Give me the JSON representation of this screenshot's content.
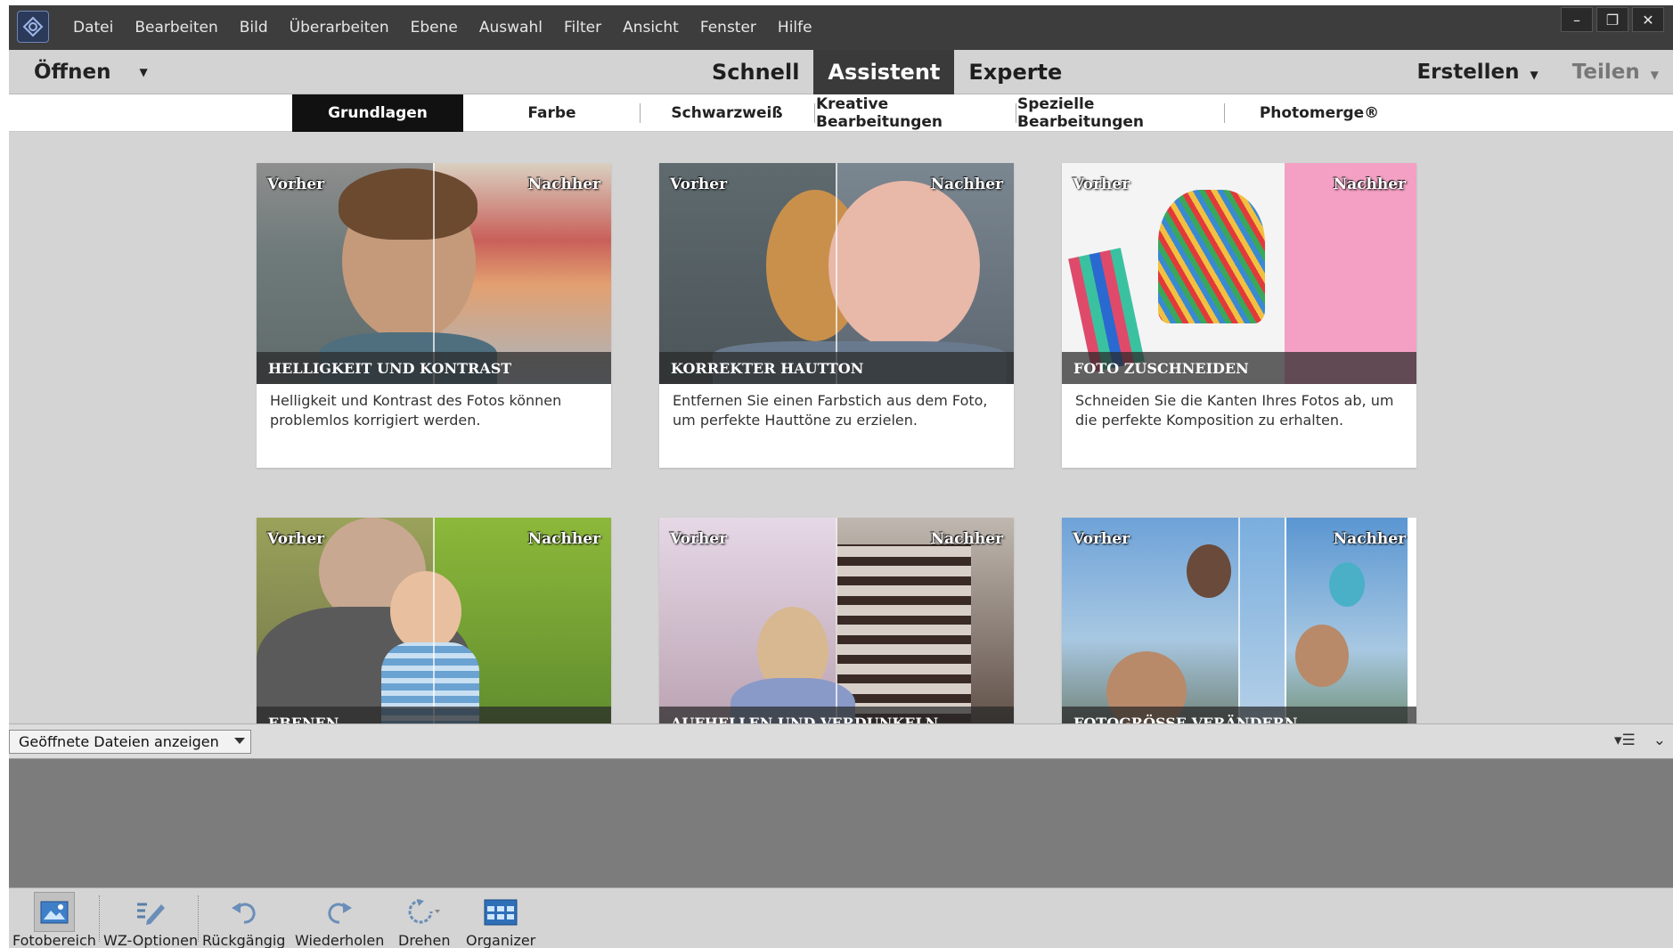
{
  "menu": {
    "items": [
      "Datei",
      "Bearbeiten",
      "Bild",
      "Überarbeiten",
      "Ebene",
      "Auswahl",
      "Filter",
      "Ansicht",
      "Fenster",
      "Hilfe"
    ]
  },
  "window_controls": {
    "minimize": "–",
    "restore": "❐",
    "close": "✕"
  },
  "modebar": {
    "open_label": "Öffnen",
    "modes": [
      "Schnell",
      "Assistent",
      "Experte"
    ],
    "active_mode": "Assistent",
    "create_label": "Erstellen",
    "share_label": "Teilen"
  },
  "category_tabs": {
    "items": [
      "Grundlagen",
      "Farbe",
      "Schwarzweiß",
      "Kreative Bearbeitungen",
      "Spezielle Bearbeitungen",
      "Photomerge®"
    ],
    "active": "Grundlagen"
  },
  "cards": [
    {
      "before": "Vorher",
      "after": "Nachher",
      "title": "HELLIGKEIT UND KONTRAST",
      "description": "Helligkeit und Kontrast des Fotos können problemlos korrigiert werden."
    },
    {
      "before": "Vorher",
      "after": "Nachher",
      "title": "KORREKTER HAUTTON",
      "description": "Entfernen Sie einen Farbstich aus dem Foto, um perfekte Hauttöne zu erzielen."
    },
    {
      "before": "Vorher",
      "after": "Nachher",
      "title": "FOTO ZUSCHNEIDEN",
      "description": "Schneiden Sie die Kanten Ihres Fotos ab, um die perfekte Komposition zu erhalten."
    },
    {
      "before": "Vorher",
      "after": "Nachher",
      "title": "EBENEN",
      "description": ""
    },
    {
      "before": "Vorher",
      "after": "Nachher",
      "title": "AUFHELLEN UND VERDUNKELN",
      "description": ""
    },
    {
      "before": "Vorher",
      "after": "Nachher",
      "title": "FOTOGRÖSSE VERÄNDERN",
      "description": ""
    }
  ],
  "project_bin": {
    "selector_value": "Geöffnete Dateien anzeigen"
  },
  "taskbar": {
    "tools": [
      "Fotobereich",
      "WZ-Optionen",
      "Rückgängig",
      "Wiederholen",
      "Drehen",
      "Organizer"
    ]
  },
  "colors": {
    "menubar_bg": "#3d3d3d",
    "active_mode_bg": "#3a3a3a",
    "active_tab_bg": "#111111",
    "content_bg": "#d4d4d4",
    "bin_bg": "#7c7c7c",
    "accent_icon": "#3f7fc8"
  }
}
